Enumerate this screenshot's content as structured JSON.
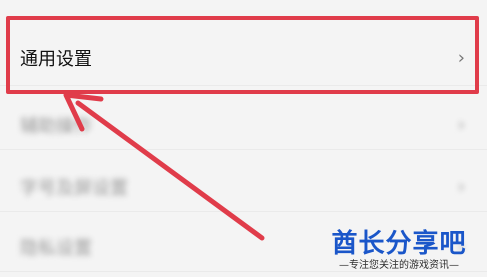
{
  "settings": {
    "items": [
      {
        "label": "通用设置",
        "chevron": "›"
      },
      {
        "label": "辅助操作",
        "chevron": "›"
      },
      {
        "label": "字号及屏设置",
        "chevron": "›"
      },
      {
        "label": "隐私设置",
        "chevron": "›"
      }
    ]
  },
  "annotation": {
    "highlight_color": "#e03c4a",
    "arrow_color": "#e03c4a"
  },
  "watermark": {
    "brand": "酋长分享吧",
    "slogan": "—专注您关注的游戏资讯—",
    "brand_color": "#1a56c9"
  }
}
